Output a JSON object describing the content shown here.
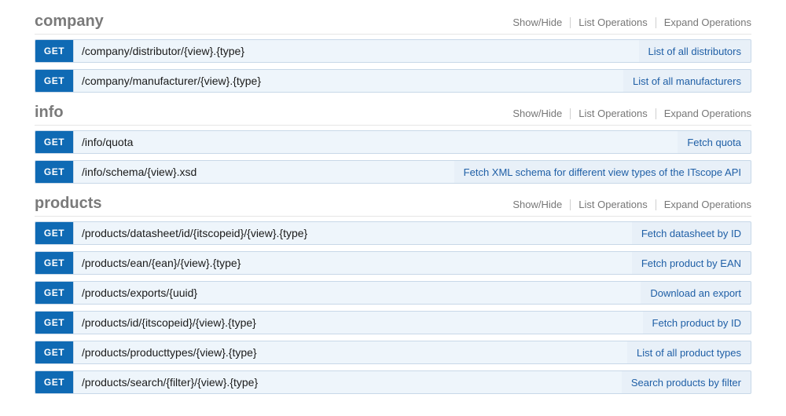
{
  "actions": {
    "show_hide": "Show/Hide",
    "list_ops": "List Operations",
    "expand_ops": "Expand Operations"
  },
  "method_label": "GET",
  "sections": [
    {
      "title": "company",
      "ops": [
        {
          "path": "/company/distributor/{view}.{type}",
          "desc": "List of all distributors"
        },
        {
          "path": "/company/manufacturer/{view}.{type}",
          "desc": "List of all manufacturers"
        }
      ]
    },
    {
      "title": "info",
      "ops": [
        {
          "path": "/info/quota",
          "desc": "Fetch quota"
        },
        {
          "path": "/info/schema/{view}.xsd",
          "desc": "Fetch XML schema for different view types of the ITscope API"
        }
      ]
    },
    {
      "title": "products",
      "ops": [
        {
          "path": "/products/datasheet/id/{itscopeid}/{view}.{type}",
          "desc": "Fetch datasheet by ID"
        },
        {
          "path": "/products/ean/{ean}/{view}.{type}",
          "desc": "Fetch product by EAN"
        },
        {
          "path": "/products/exports/{uuid}",
          "desc": "Download an export"
        },
        {
          "path": "/products/id/{itscopeid}/{view}.{type}",
          "desc": "Fetch product by ID"
        },
        {
          "path": "/products/producttypes/{view}.{type}",
          "desc": "List of all product types"
        },
        {
          "path": "/products/search/{filter}/{view}.{type}",
          "desc": "Search products by filter"
        }
      ]
    }
  ]
}
